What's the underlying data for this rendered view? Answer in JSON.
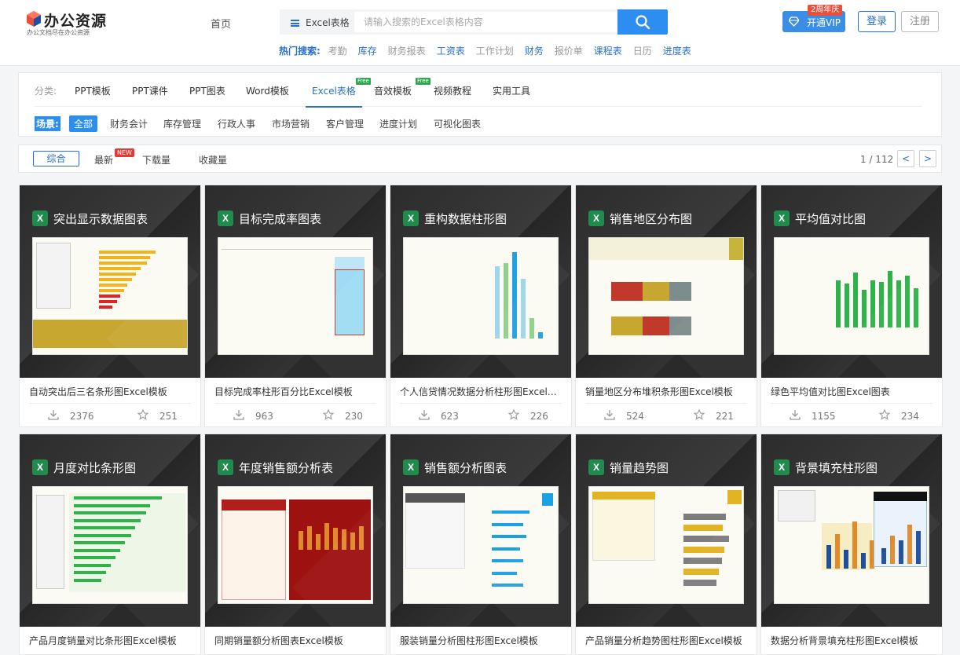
{
  "logo": {
    "title": "办公资源",
    "sub": "办公文档尽在办公资源"
  },
  "nav": {
    "home": "首页"
  },
  "search": {
    "category": "Excel表格",
    "placeholder": "请输入搜索的Excel表格内容",
    "icon": "search-icon"
  },
  "hot": {
    "label": "热门搜索:",
    "items": [
      {
        "text": "考勤",
        "style": "gray"
      },
      {
        "text": "库存",
        "style": "blue"
      },
      {
        "text": "财务报表",
        "style": "gray"
      },
      {
        "text": "工资表",
        "style": "blue"
      },
      {
        "text": "工作计划",
        "style": "gray"
      },
      {
        "text": "财务",
        "style": "blue"
      },
      {
        "text": "报价单",
        "style": "gray"
      },
      {
        "text": "课程表",
        "style": "blue"
      },
      {
        "text": "日历",
        "style": "gray"
      },
      {
        "text": "进度表",
        "style": "blue"
      }
    ]
  },
  "account": {
    "vip_badge": "2周年庆",
    "vip_label": "开通VIP",
    "login": "登录",
    "register": "注册"
  },
  "filter": {
    "category_label": "分类:",
    "categories": [
      "PPT模板",
      "PPT课件",
      "PPT图表",
      "Word模板",
      "Excel表格",
      "音效模板",
      "视频教程",
      "实用工具"
    ],
    "active_category": "Excel表格",
    "free_tag": "Free",
    "scene_label": "场景:",
    "scenes": [
      "全部",
      "财务会计",
      "库存管理",
      "行政人事",
      "市场营销",
      "客户管理",
      "进度计划",
      "可视化图表"
    ],
    "active_scene": "全部"
  },
  "sort": {
    "items": [
      "综合",
      "最新",
      "下载量",
      "收藏量"
    ],
    "active": "综合",
    "new_tag": "NEW",
    "page_text": "1 / 112",
    "prev": "<",
    "next": ">"
  },
  "colors": {
    "accent": "#2b8ef0",
    "brand_blue": "#2a6fc9",
    "excel_green": "#1f8b4c",
    "badge_red": "#e94f3d"
  },
  "cards": [
    {
      "heading": "突出显示数据图表",
      "title": "自动突出后三名条形图Excel模板",
      "downloads": "2376",
      "favorites": "251"
    },
    {
      "heading": "目标完成率图表",
      "title": "目标完成率柱形百分比Excel模板",
      "downloads": "963",
      "favorites": "230"
    },
    {
      "heading": "重构数据柱形图",
      "title": "个人信贷情况数据分析柱形图Excel模板",
      "downloads": "623",
      "favorites": "226"
    },
    {
      "heading": "销售地区分布图",
      "title": "销量地区分布堆积条形图Excel模板",
      "downloads": "524",
      "favorites": "221"
    },
    {
      "heading": "平均值对比图",
      "title": "绿色平均值对比图Excel图表",
      "downloads": "1155",
      "favorites": "234"
    },
    {
      "heading": "月度对比条形图",
      "title": "产品月度销量对比条形图Excel模板",
      "downloads": "",
      "favorites": ""
    },
    {
      "heading": "年度销售额分析表",
      "title": "同期销量额分析图表Excel模板",
      "downloads": "",
      "favorites": ""
    },
    {
      "heading": "销售额分析图表",
      "title": "服装销量分析图柱形图Excel模板",
      "downloads": "",
      "favorites": ""
    },
    {
      "heading": "销量趋势图",
      "title": "产品销量分析趋势图柱形图Excel模板",
      "downloads": "",
      "favorites": ""
    },
    {
      "heading": "背景填充柱形图",
      "title": "数据分析背景填充柱形图Excel模板",
      "downloads": "",
      "favorites": ""
    }
  ]
}
